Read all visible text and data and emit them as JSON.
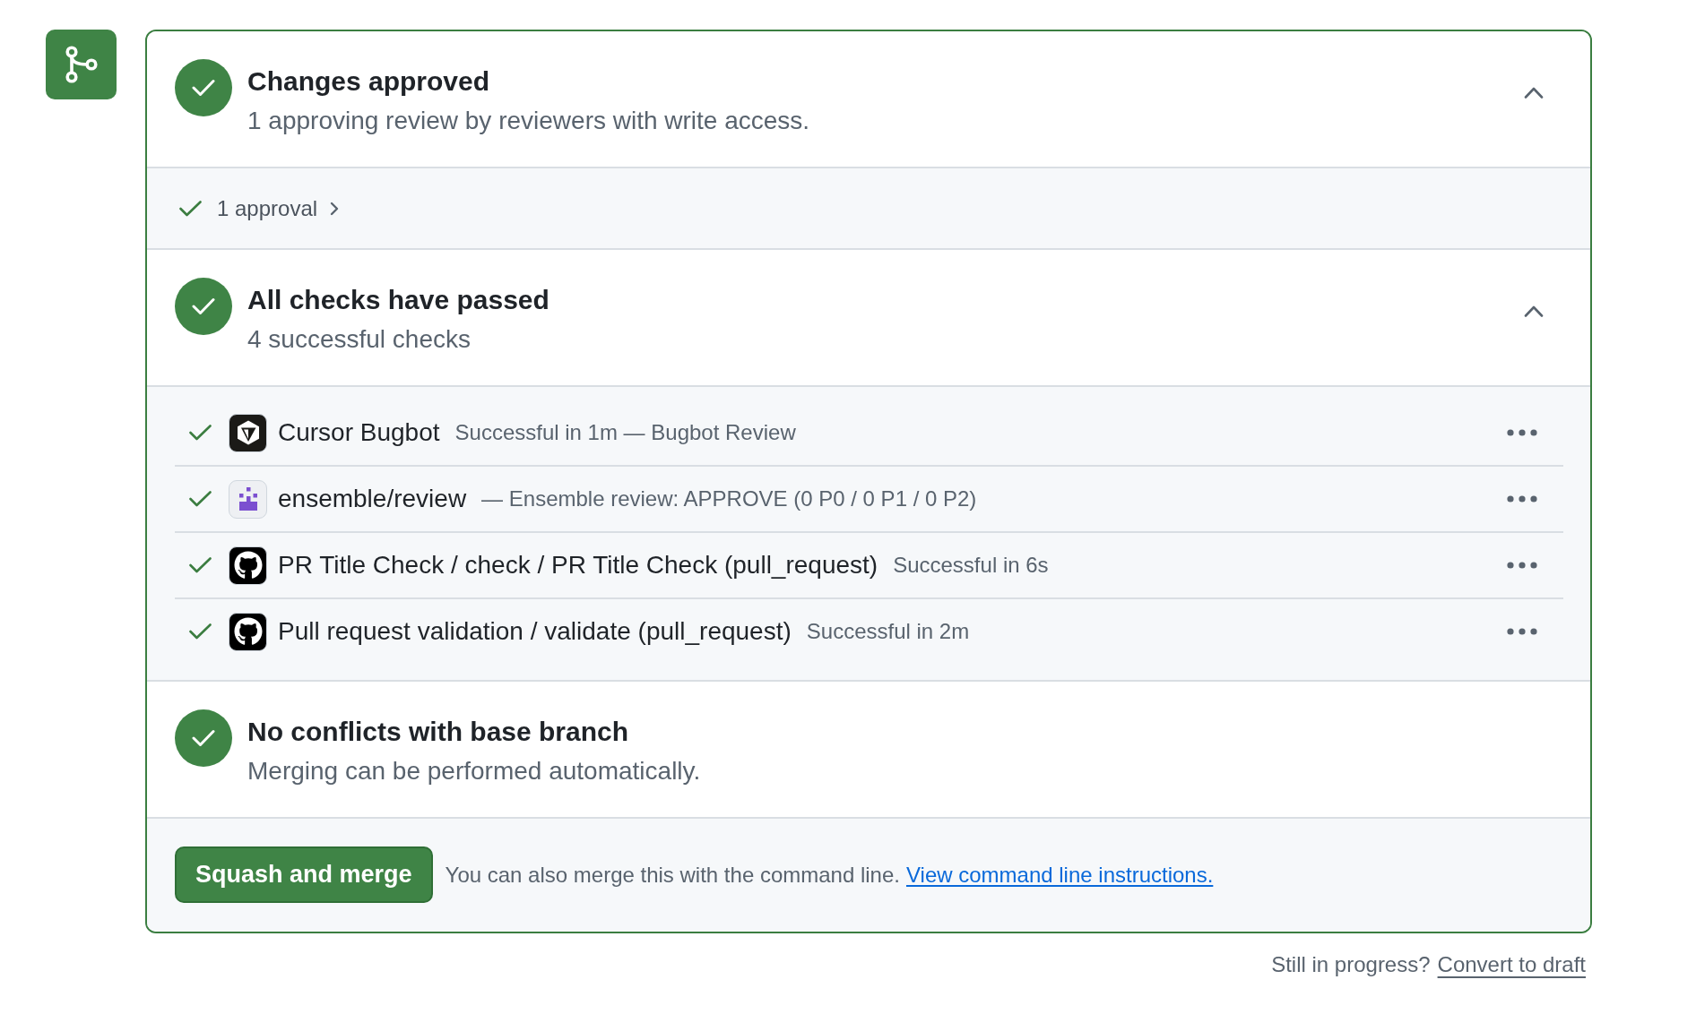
{
  "merge_box": {
    "review": {
      "title": "Changes approved",
      "subtitle": "1 approving review by reviewers with write access.",
      "passed": true,
      "expanded": true
    },
    "approvals": {
      "label": "1 approval",
      "passed": true
    },
    "checks_summary": {
      "title": "All checks have passed",
      "subtitle": "4 successful checks",
      "passed": true,
      "expanded": true
    },
    "checks": [
      {
        "kind": "cube",
        "name": "Cursor Bugbot",
        "detail": "Successful in 1m — Bugbot Review",
        "passed": true
      },
      {
        "kind": "pixel",
        "name": "ensemble/review",
        "detail": "— Ensemble review: APPROVE (0 P0 / 0 P1 / 0 P2)",
        "passed": true
      },
      {
        "kind": "cat",
        "name": "PR Title Check / check / PR Title Check (pull_request)",
        "detail": "Successful in 6s",
        "passed": true
      },
      {
        "kind": "cat",
        "name": "Pull request validation / validate (pull_request)",
        "detail": "Successful in 2m",
        "passed": true
      }
    ],
    "conflicts": {
      "title": "No conflicts with base branch",
      "subtitle": "Merging can be performed automatically.",
      "passed": true
    },
    "merge": {
      "button": "Squash and merge",
      "hint": "You can also merge this with the command line.",
      "link": "View command line instructions."
    }
  },
  "footer": {
    "text": "Still in progress?",
    "link": "Convert to draft"
  }
}
